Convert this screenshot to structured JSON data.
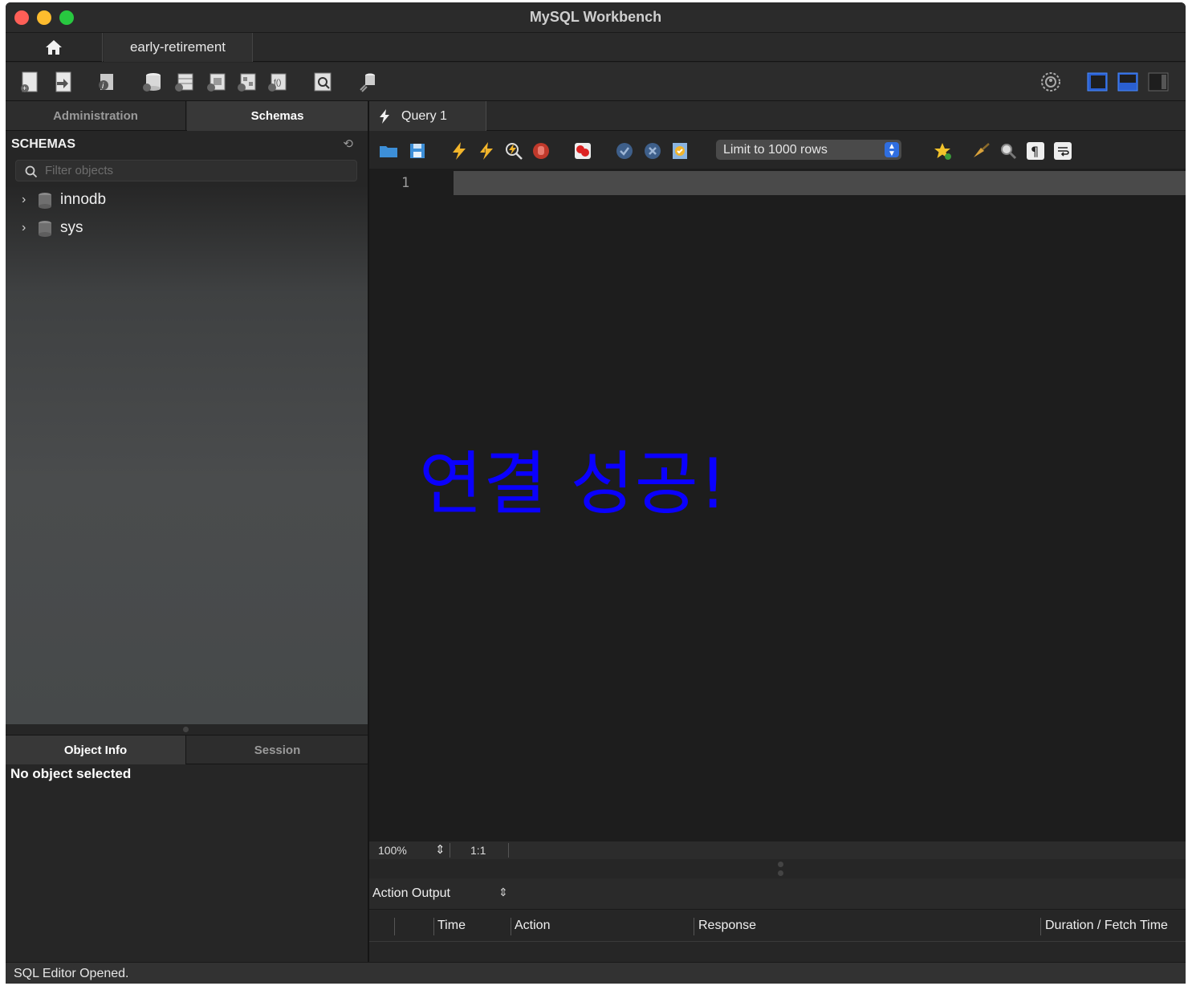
{
  "window": {
    "title": "MySQL Workbench"
  },
  "connection_tabs": {
    "home_icon": "home-icon",
    "active": "early-retirement"
  },
  "left_tabs": {
    "administration": "Administration",
    "schemas": "Schemas"
  },
  "schemas_panel": {
    "title": "SCHEMAS",
    "filter_placeholder": "Filter objects",
    "items": [
      {
        "label": "innodb"
      },
      {
        "label": "sys"
      }
    ]
  },
  "info_tabs": {
    "object_info": "Object Info",
    "session": "Session"
  },
  "object_info": {
    "text": "No object selected"
  },
  "query_tab": {
    "label": "Query 1"
  },
  "query_toolbar": {
    "limit": "Limit to 1000 rows"
  },
  "editor": {
    "line_number": "1",
    "overlay_text": "연결 성공!"
  },
  "editor_status": {
    "zoom": "100%",
    "position": "1:1"
  },
  "output": {
    "selector": "Action Output",
    "columns": [
      "Time",
      "Action",
      "Response",
      "Duration / Fetch Time"
    ]
  },
  "status_bar": {
    "text": "SQL Editor Opened."
  },
  "colors": {
    "accent_blue": "#2f6ee0",
    "overlay_text": "#0a00ff"
  }
}
